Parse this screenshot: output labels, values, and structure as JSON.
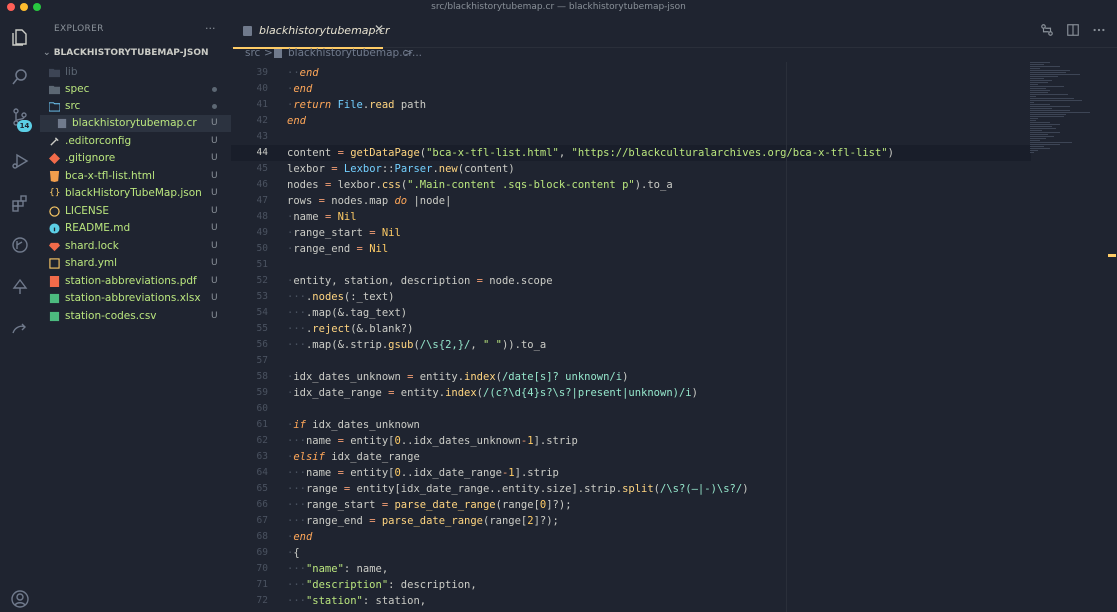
{
  "window": {
    "title": "src/blackhistorytubemap.cr — blackhistorytubemap-json"
  },
  "activity": {
    "scm_badge": "14"
  },
  "explorer": {
    "header": "EXPLORER",
    "more": "···",
    "root": "BLACKHISTORYTUBEMAP-JSON",
    "items": [
      {
        "label": "lib",
        "status": "",
        "kind": "folder"
      },
      {
        "label": "spec",
        "status": "",
        "kind": "folder"
      },
      {
        "label": "src",
        "status": "",
        "kind": "folder"
      },
      {
        "label": "blackhistorytubemap.cr",
        "status": "U",
        "kind": "file"
      },
      {
        "label": ".editorconfig",
        "status": "U",
        "kind": "file"
      },
      {
        "label": ".gitignore",
        "status": "U",
        "kind": "file"
      },
      {
        "label": "bca-x-tfl-list.html",
        "status": "U",
        "kind": "file"
      },
      {
        "label": "blackHistoryTubeMap.json",
        "status": "U",
        "kind": "file"
      },
      {
        "label": "LICENSE",
        "status": "U",
        "kind": "file"
      },
      {
        "label": "README.md",
        "status": "U",
        "kind": "file"
      },
      {
        "label": "shard.lock",
        "status": "U",
        "kind": "file"
      },
      {
        "label": "shard.yml",
        "status": "U",
        "kind": "file"
      },
      {
        "label": "station-abbreviations.pdf",
        "status": "U",
        "kind": "file"
      },
      {
        "label": "station-abbreviations.xlsx",
        "status": "U",
        "kind": "file"
      },
      {
        "label": "station-codes.csv",
        "status": "U",
        "kind": "file"
      }
    ]
  },
  "tab": {
    "label": "blackhistorytubemap.cr",
    "close": "✕"
  },
  "breadcrumb": {
    "src": "src",
    "sep1": ">",
    "file": "blackhistorytubemap.cr",
    "sep2": ">",
    "rest": "..."
  },
  "code": {
    "line_numbers": [
      "39",
      "40",
      "41",
      "42",
      "43",
      "44",
      "45",
      "46",
      "47",
      "48",
      "49",
      "50",
      "51",
      "52",
      "53",
      "54",
      "55",
      "56",
      "57",
      "58",
      "59",
      "60",
      "61",
      "62",
      "63",
      "64",
      "65",
      "66",
      "67",
      "68",
      "69",
      "70",
      "71",
      "72"
    ],
    "current_line": "44"
  },
  "colors": {
    "accent": "#ffcc66",
    "background": "#1f2430",
    "string": "#bae67e",
    "keyword": "#ffa759"
  }
}
